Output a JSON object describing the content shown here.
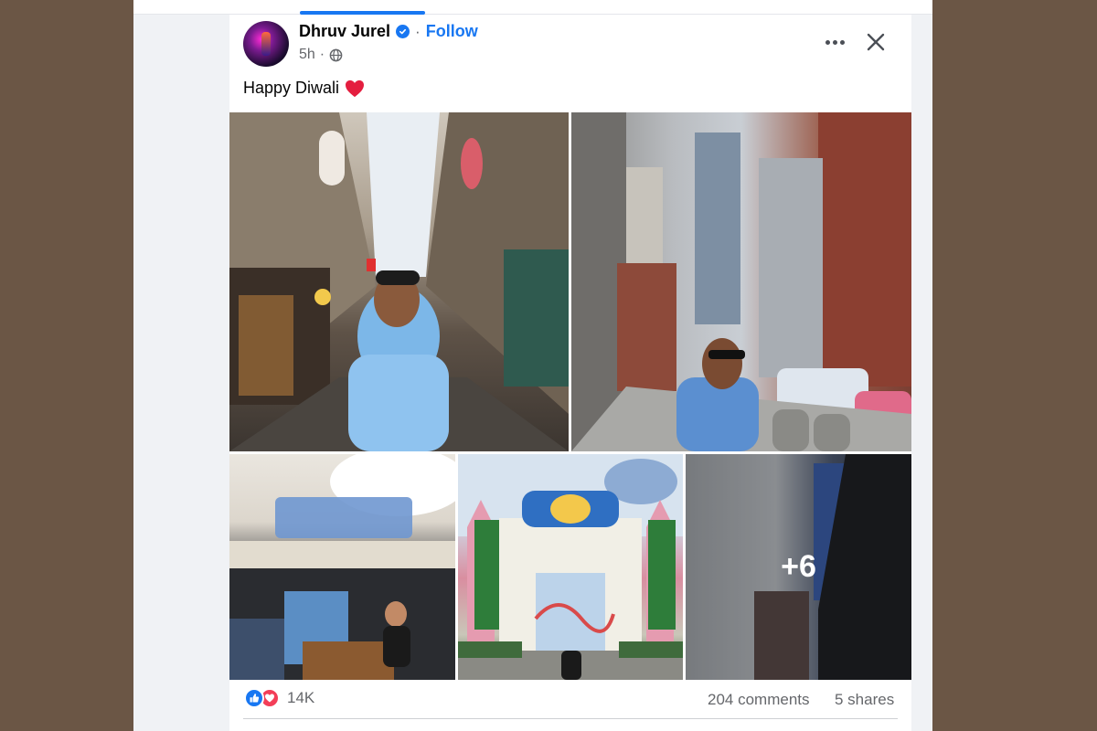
{
  "post": {
    "author": "Dhruv Jurel",
    "follow_label": "Follow",
    "separator": "·",
    "time": "5h",
    "text": "Happy Diwali",
    "photos_more_count": "+6"
  },
  "engagement": {
    "reaction_count": "14K",
    "comments": "204 comments",
    "shares": "5 shares"
  },
  "icons": {
    "verified": "verified-badge-icon",
    "audience": "globe-icon",
    "more": "more-options-icon",
    "close": "close-icon",
    "emoji": "red-heart-emoji",
    "reactions": [
      "like-icon",
      "love-icon"
    ]
  },
  "colors": {
    "accent": "#1877f2",
    "love": "#f33e58",
    "muted_text": "#65676b"
  }
}
